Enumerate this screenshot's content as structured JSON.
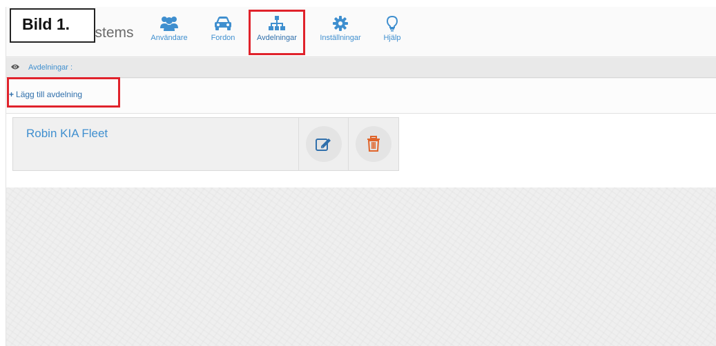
{
  "annotation": {
    "label": "Bild 1."
  },
  "header": {
    "brand_text": "ystems",
    "nav": [
      {
        "label": "Användare",
        "icon": "users-icon"
      },
      {
        "label": "Fordon",
        "icon": "car-icon"
      },
      {
        "label": "Avdelningar",
        "icon": "sitemap-icon",
        "active": true
      },
      {
        "label": "Inställningar",
        "icon": "gear-icon"
      },
      {
        "label": "Hjälp",
        "icon": "lightbulb-icon"
      }
    ]
  },
  "breadcrumb": {
    "icon": "eye-icon",
    "label": "Avdelningar :"
  },
  "toolbar": {
    "add_icon": "plus-icon",
    "add_label": "Lägg till avdelning"
  },
  "departments": [
    {
      "name": "Robin KIA Fleet",
      "edit_icon": "edit-icon",
      "delete_icon": "trash-icon"
    }
  ],
  "colors": {
    "link": "#3f8fcf",
    "highlight": "#e0222b",
    "delete": "#e0642a"
  }
}
